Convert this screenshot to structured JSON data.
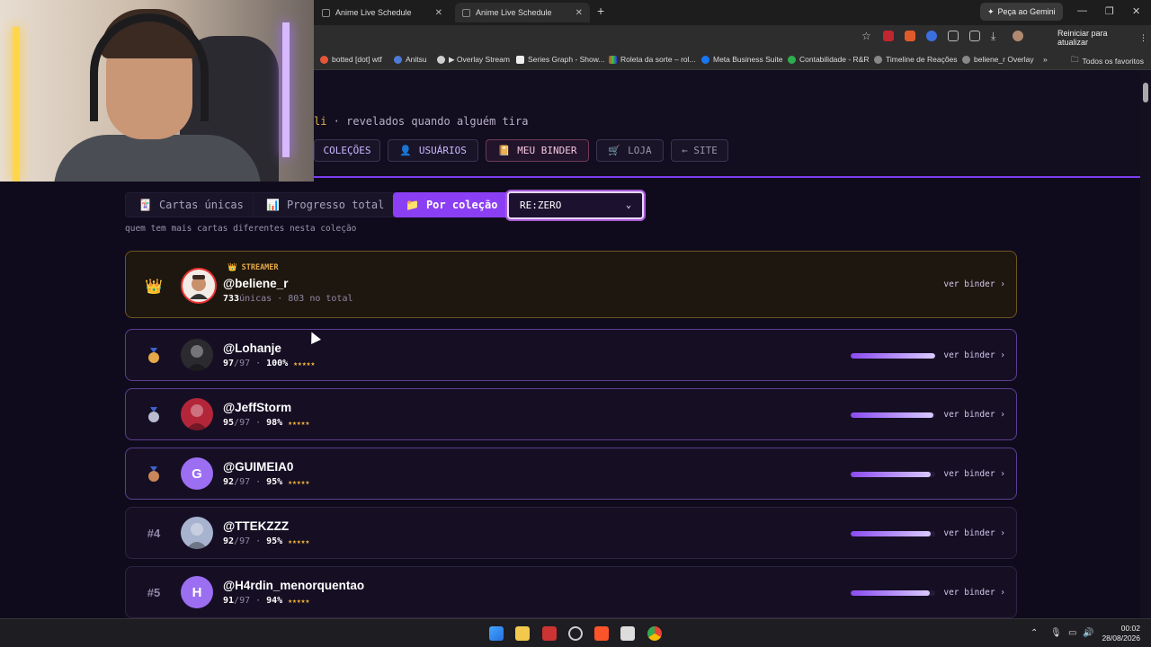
{
  "browser": {
    "tabs": [
      {
        "label": "Anime Live Schedule",
        "active": false
      },
      {
        "label": "Anime Live Schedule",
        "active": true
      }
    ],
    "gemini_label": "Peça ao Gemini",
    "restart_label": "Reiniciar para atualizar",
    "bookmarks": [
      "botted [dot] wtf",
      "Anitsu",
      "▶ Overlay Stream",
      "Series Graph - Show...",
      "Roleta da sorte – rol...",
      "Meta Business Suite",
      "Contabilidade - R&R",
      "Timeline de Reações",
      "beliene_r Overlay"
    ],
    "bookmarks_more": "»",
    "all_favorites": "Todos os favoritos"
  },
  "header": {
    "subtitle_highlight": "li",
    "subtitle_rest": " · revelados quando alguém tira",
    "nav": [
      {
        "label": "COLEÇÕES",
        "icon": "",
        "style": "normal"
      },
      {
        "label": "USUÁRIOS",
        "icon": "👤",
        "style": "normal"
      },
      {
        "label": "MEU BINDER",
        "icon": "📔",
        "style": "hot"
      },
      {
        "label": "LOJA",
        "icon": "🛒",
        "style": "dim"
      },
      {
        "label": "← SITE",
        "icon": "",
        "style": "dim"
      }
    ]
  },
  "filters": {
    "options": [
      {
        "label": "Cartas únicas",
        "icon": "🃏",
        "active": false
      },
      {
        "label": "Progresso total",
        "icon": "📊",
        "active": false
      },
      {
        "label": "Por coleção",
        "icon": "📁",
        "active": true
      }
    ],
    "collection_selected": "RE:ZERO",
    "hint": "quem tem mais cartas diferentes nesta coleção"
  },
  "streamer": {
    "tag": "STREAMER",
    "tag_icon": "👑",
    "rank_icon": "👑",
    "name": "@beliene_r",
    "unique_count": "733",
    "unique_label": " únicas · 803 no total",
    "link": "ver binder ›"
  },
  "ranking": [
    {
      "rank": "",
      "medal": "gold",
      "name": "@Lohanje",
      "have": "97",
      "total": "/97",
      "percent": "100%",
      "stars": "★★★★★",
      "progress": 1.0,
      "avatar_letter": "",
      "avatar_color": "#2b2a2f",
      "link": "ver binder ›"
    },
    {
      "rank": "",
      "medal": "silver",
      "name": "@JeffStorm",
      "have": "95",
      "total": "/97",
      "percent": "98%",
      "stars": "★★★★★",
      "progress": 0.98,
      "avatar_letter": "",
      "avatar_color": "#b3263a",
      "link": "ver binder ›"
    },
    {
      "rank": "",
      "medal": "bronze",
      "name": "@GUIMEIA0",
      "have": "92",
      "total": "/97",
      "percent": "95%",
      "stars": "★★★★★",
      "progress": 0.95,
      "avatar_letter": "G",
      "avatar_color": "#9b6ef2",
      "link": "ver binder ›"
    },
    {
      "rank": "#4",
      "medal": "",
      "name": "@TTEKZZZ",
      "have": "92",
      "total": "/97",
      "percent": "95%",
      "stars": "★★★★★",
      "progress": 0.95,
      "avatar_letter": "",
      "avatar_color": "#a8b4cf",
      "link": "ver binder ›"
    },
    {
      "rank": "#5",
      "medal": "",
      "name": "@H4rdin_menorquentao",
      "have": "91",
      "total": "/97",
      "percent": "94%",
      "stars": "★★★★★",
      "progress": 0.94,
      "avatar_letter": "H",
      "avatar_color": "#9b6ef2",
      "link": "ver binder ›"
    }
  ],
  "taskbar": {
    "time": "00:02",
    "date": "28/08/2026"
  },
  "colors": {
    "accent": "#8b3ff5",
    "streamer_gold": "#e3a94a",
    "stars": "#f3b53a"
  }
}
